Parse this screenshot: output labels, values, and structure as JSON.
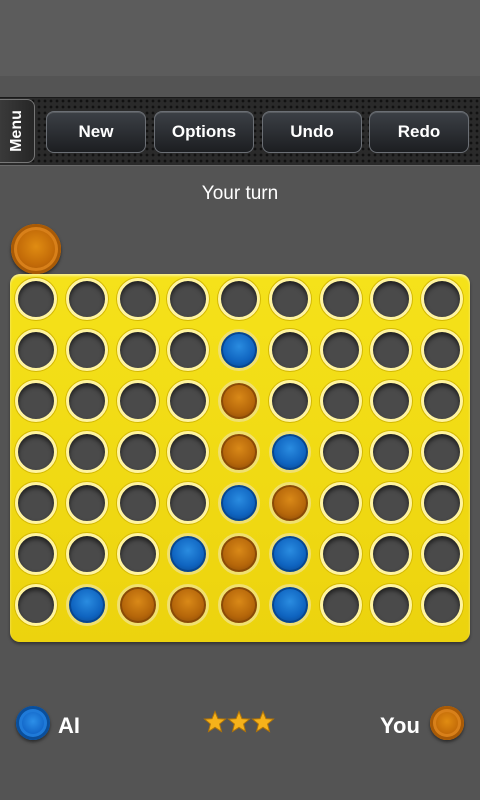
{
  "toolbar": {
    "menu_label": "Menu",
    "buttons": [
      "New",
      "Options",
      "Undo",
      "Redo"
    ]
  },
  "status": {
    "turn_text": "Your turn"
  },
  "colors": {
    "board": "#f0d814",
    "player_ai": "#1266c8",
    "player_you": "#c26a08",
    "empty_hole": "#4a4a4a"
  },
  "board": {
    "columns": 9,
    "rows": 7,
    "cells": [
      [
        "e",
        "e",
        "e",
        "e",
        "e",
        "e",
        "e",
        "e",
        "e"
      ],
      [
        "e",
        "e",
        "e",
        "e",
        "b",
        "e",
        "e",
        "e",
        "e"
      ],
      [
        "e",
        "e",
        "e",
        "e",
        "o",
        "e",
        "e",
        "e",
        "e"
      ],
      [
        "e",
        "e",
        "e",
        "e",
        "o",
        "b",
        "e",
        "e",
        "e"
      ],
      [
        "e",
        "e",
        "e",
        "e",
        "b",
        "o",
        "e",
        "e",
        "e"
      ],
      [
        "e",
        "e",
        "e",
        "b",
        "o",
        "b",
        "e",
        "e",
        "e"
      ],
      [
        "e",
        "b",
        "o",
        "o",
        "o",
        "b",
        "e",
        "e",
        "e"
      ]
    ]
  },
  "footer": {
    "ai_label": "AI",
    "you_label": "You",
    "difficulty_stars": 3
  }
}
